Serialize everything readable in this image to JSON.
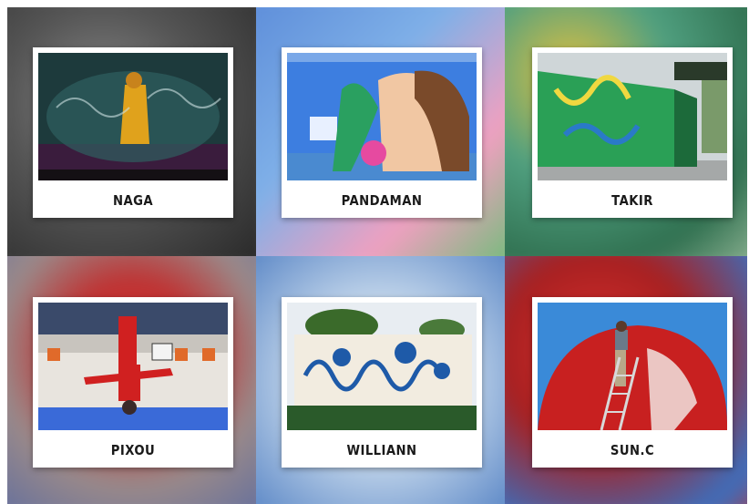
{
  "tiles": [
    {
      "name": "NAGA"
    },
    {
      "name": "PANDAMAN"
    },
    {
      "name": "TAKIR"
    },
    {
      "name": "PIXOU"
    },
    {
      "name": "WILLIANN"
    },
    {
      "name": "SUN.C"
    }
  ]
}
